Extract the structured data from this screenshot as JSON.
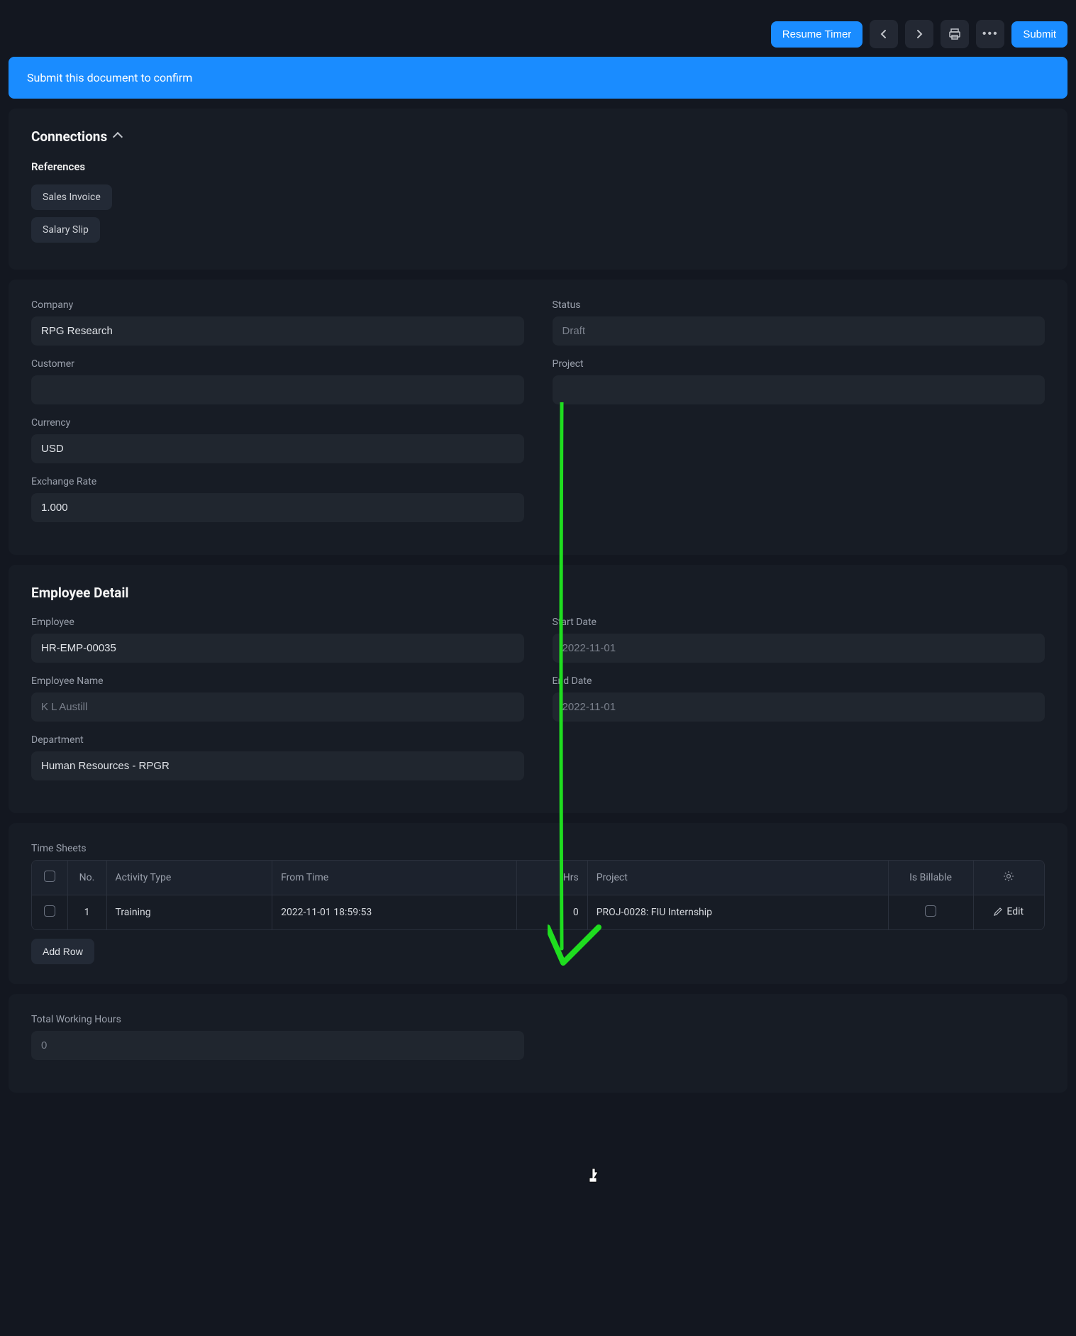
{
  "topbar": {
    "resume_timer": "Resume Timer",
    "submit": "Submit"
  },
  "banner": {
    "text": "Submit this document to confirm"
  },
  "connections": {
    "title": "Connections",
    "references_label": "References",
    "items": [
      "Sales Invoice",
      "Salary Slip"
    ]
  },
  "company_section": {
    "company_label": "Company",
    "company_value": "RPG Research",
    "customer_label": "Customer",
    "customer_value": "",
    "currency_label": "Currency",
    "currency_value": "USD",
    "exchange_label": "Exchange Rate",
    "exchange_value": "1.000",
    "status_label": "Status",
    "status_value": "Draft",
    "project_label": "Project",
    "project_value": ""
  },
  "employee_detail": {
    "title": "Employee Detail",
    "employee_label": "Employee",
    "employee_value": "HR-EMP-00035",
    "employee_name_label": "Employee Name",
    "employee_name_value": "K L Austill",
    "department_label": "Department",
    "department_value": "Human Resources - RPGR",
    "start_date_label": "Start Date",
    "start_date_value": "2022-11-01",
    "end_date_label": "End Date",
    "end_date_value": "2022-11-01"
  },
  "timesheets": {
    "label": "Time Sheets",
    "headers": {
      "no": "No.",
      "activity": "Activity Type",
      "from": "From Time",
      "hrs": "Hrs",
      "project": "Project",
      "billable": "Is Billable"
    },
    "rows": [
      {
        "no": "1",
        "activity": "Training",
        "from": "2022-11-01 18:59:53",
        "hrs": "0",
        "project": "PROJ-0028: FIU Internship",
        "edit": "Edit"
      }
    ],
    "add_row": "Add Row"
  },
  "totals": {
    "working_hours_label": "Total Working Hours",
    "working_hours_value": "0"
  }
}
